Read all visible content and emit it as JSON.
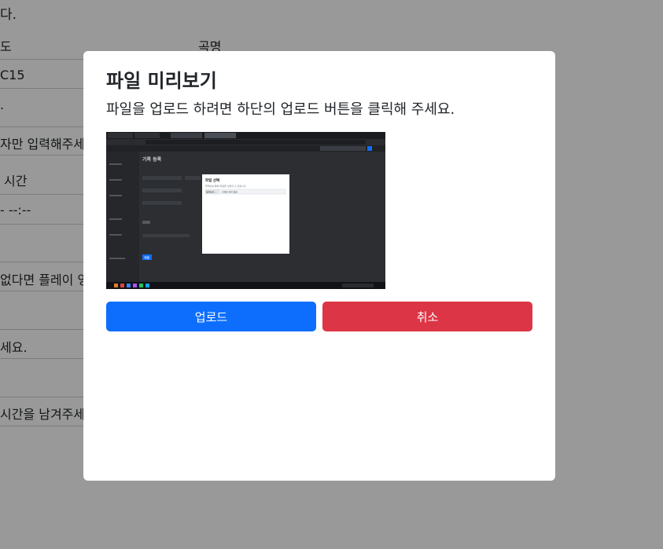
{
  "background_page": {
    "row1": "다.",
    "col_header_left": "도",
    "col_header_right": "곡명",
    "row_value1": "C15",
    "row_dot": ".",
    "row_hint1": "자만 입력해주세요",
    "row_time_label": "시간",
    "row_time_value": "-  --:--",
    "row_hint2": "없다면 플레이 영상",
    "row_hint3": "세요.",
    "row_hint4": "시간을 남겨주세요"
  },
  "modal": {
    "title": "파일 미리보기",
    "description": "파일을 업로드 하려면 하단의 업로드 버튼을 클릭해 주세요.",
    "preview_image": {
      "page_heading": "기록 등록",
      "dialog_title": "파일 선택",
      "dialog_text": "플레이를 통해 파일을 선택할 수 있습니다.",
      "file_button": "찾아보기...",
      "file_status": "선택된 파일 없음",
      "submit_label": "제출"
    },
    "upload_label": "업로드",
    "cancel_label": "취소"
  }
}
